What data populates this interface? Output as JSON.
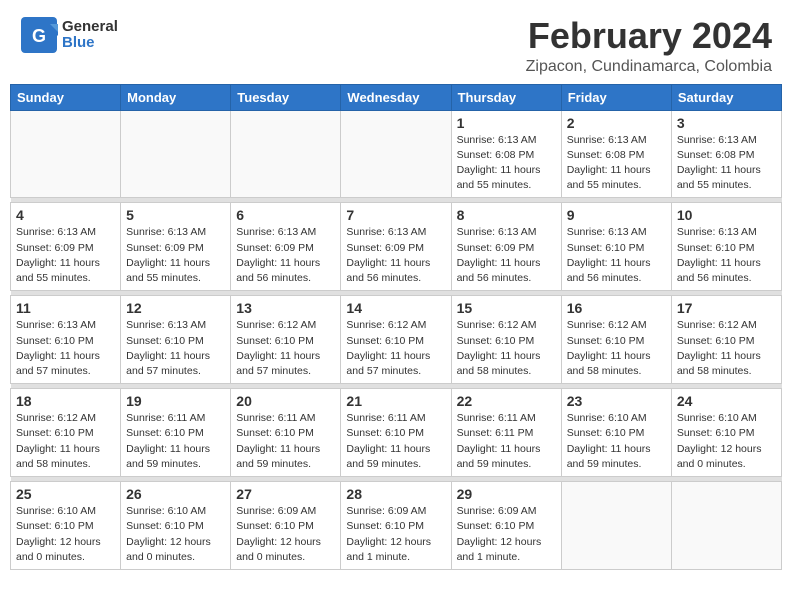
{
  "header": {
    "logo_general": "General",
    "logo_blue": "Blue",
    "month_title": "February 2024",
    "location": "Zipacon, Cundinamarca, Colombia"
  },
  "days_of_week": [
    "Sunday",
    "Monday",
    "Tuesday",
    "Wednesday",
    "Thursday",
    "Friday",
    "Saturday"
  ],
  "weeks": [
    [
      {
        "day": "",
        "info": ""
      },
      {
        "day": "",
        "info": ""
      },
      {
        "day": "",
        "info": ""
      },
      {
        "day": "",
        "info": ""
      },
      {
        "day": "1",
        "info": "Sunrise: 6:13 AM\nSunset: 6:08 PM\nDaylight: 11 hours\nand 55 minutes."
      },
      {
        "day": "2",
        "info": "Sunrise: 6:13 AM\nSunset: 6:08 PM\nDaylight: 11 hours\nand 55 minutes."
      },
      {
        "day": "3",
        "info": "Sunrise: 6:13 AM\nSunset: 6:08 PM\nDaylight: 11 hours\nand 55 minutes."
      }
    ],
    [
      {
        "day": "4",
        "info": "Sunrise: 6:13 AM\nSunset: 6:09 PM\nDaylight: 11 hours\nand 55 minutes."
      },
      {
        "day": "5",
        "info": "Sunrise: 6:13 AM\nSunset: 6:09 PM\nDaylight: 11 hours\nand 55 minutes."
      },
      {
        "day": "6",
        "info": "Sunrise: 6:13 AM\nSunset: 6:09 PM\nDaylight: 11 hours\nand 56 minutes."
      },
      {
        "day": "7",
        "info": "Sunrise: 6:13 AM\nSunset: 6:09 PM\nDaylight: 11 hours\nand 56 minutes."
      },
      {
        "day": "8",
        "info": "Sunrise: 6:13 AM\nSunset: 6:09 PM\nDaylight: 11 hours\nand 56 minutes."
      },
      {
        "day": "9",
        "info": "Sunrise: 6:13 AM\nSunset: 6:10 PM\nDaylight: 11 hours\nand 56 minutes."
      },
      {
        "day": "10",
        "info": "Sunrise: 6:13 AM\nSunset: 6:10 PM\nDaylight: 11 hours\nand 56 minutes."
      }
    ],
    [
      {
        "day": "11",
        "info": "Sunrise: 6:13 AM\nSunset: 6:10 PM\nDaylight: 11 hours\nand 57 minutes."
      },
      {
        "day": "12",
        "info": "Sunrise: 6:13 AM\nSunset: 6:10 PM\nDaylight: 11 hours\nand 57 minutes."
      },
      {
        "day": "13",
        "info": "Sunrise: 6:12 AM\nSunset: 6:10 PM\nDaylight: 11 hours\nand 57 minutes."
      },
      {
        "day": "14",
        "info": "Sunrise: 6:12 AM\nSunset: 6:10 PM\nDaylight: 11 hours\nand 57 minutes."
      },
      {
        "day": "15",
        "info": "Sunrise: 6:12 AM\nSunset: 6:10 PM\nDaylight: 11 hours\nand 58 minutes."
      },
      {
        "day": "16",
        "info": "Sunrise: 6:12 AM\nSunset: 6:10 PM\nDaylight: 11 hours\nand 58 minutes."
      },
      {
        "day": "17",
        "info": "Sunrise: 6:12 AM\nSunset: 6:10 PM\nDaylight: 11 hours\nand 58 minutes."
      }
    ],
    [
      {
        "day": "18",
        "info": "Sunrise: 6:12 AM\nSunset: 6:10 PM\nDaylight: 11 hours\nand 58 minutes."
      },
      {
        "day": "19",
        "info": "Sunrise: 6:11 AM\nSunset: 6:10 PM\nDaylight: 11 hours\nand 59 minutes."
      },
      {
        "day": "20",
        "info": "Sunrise: 6:11 AM\nSunset: 6:10 PM\nDaylight: 11 hours\nand 59 minutes."
      },
      {
        "day": "21",
        "info": "Sunrise: 6:11 AM\nSunset: 6:10 PM\nDaylight: 11 hours\nand 59 minutes."
      },
      {
        "day": "22",
        "info": "Sunrise: 6:11 AM\nSunset: 6:11 PM\nDaylight: 11 hours\nand 59 minutes."
      },
      {
        "day": "23",
        "info": "Sunrise: 6:10 AM\nSunset: 6:10 PM\nDaylight: 11 hours\nand 59 minutes."
      },
      {
        "day": "24",
        "info": "Sunrise: 6:10 AM\nSunset: 6:10 PM\nDaylight: 12 hours\nand 0 minutes."
      }
    ],
    [
      {
        "day": "25",
        "info": "Sunrise: 6:10 AM\nSunset: 6:10 PM\nDaylight: 12 hours\nand 0 minutes."
      },
      {
        "day": "26",
        "info": "Sunrise: 6:10 AM\nSunset: 6:10 PM\nDaylight: 12 hours\nand 0 minutes."
      },
      {
        "day": "27",
        "info": "Sunrise: 6:09 AM\nSunset: 6:10 PM\nDaylight: 12 hours\nand 0 minutes."
      },
      {
        "day": "28",
        "info": "Sunrise: 6:09 AM\nSunset: 6:10 PM\nDaylight: 12 hours\nand 1 minute."
      },
      {
        "day": "29",
        "info": "Sunrise: 6:09 AM\nSunset: 6:10 PM\nDaylight: 12 hours\nand 1 minute."
      },
      {
        "day": "",
        "info": ""
      },
      {
        "day": "",
        "info": ""
      }
    ]
  ]
}
